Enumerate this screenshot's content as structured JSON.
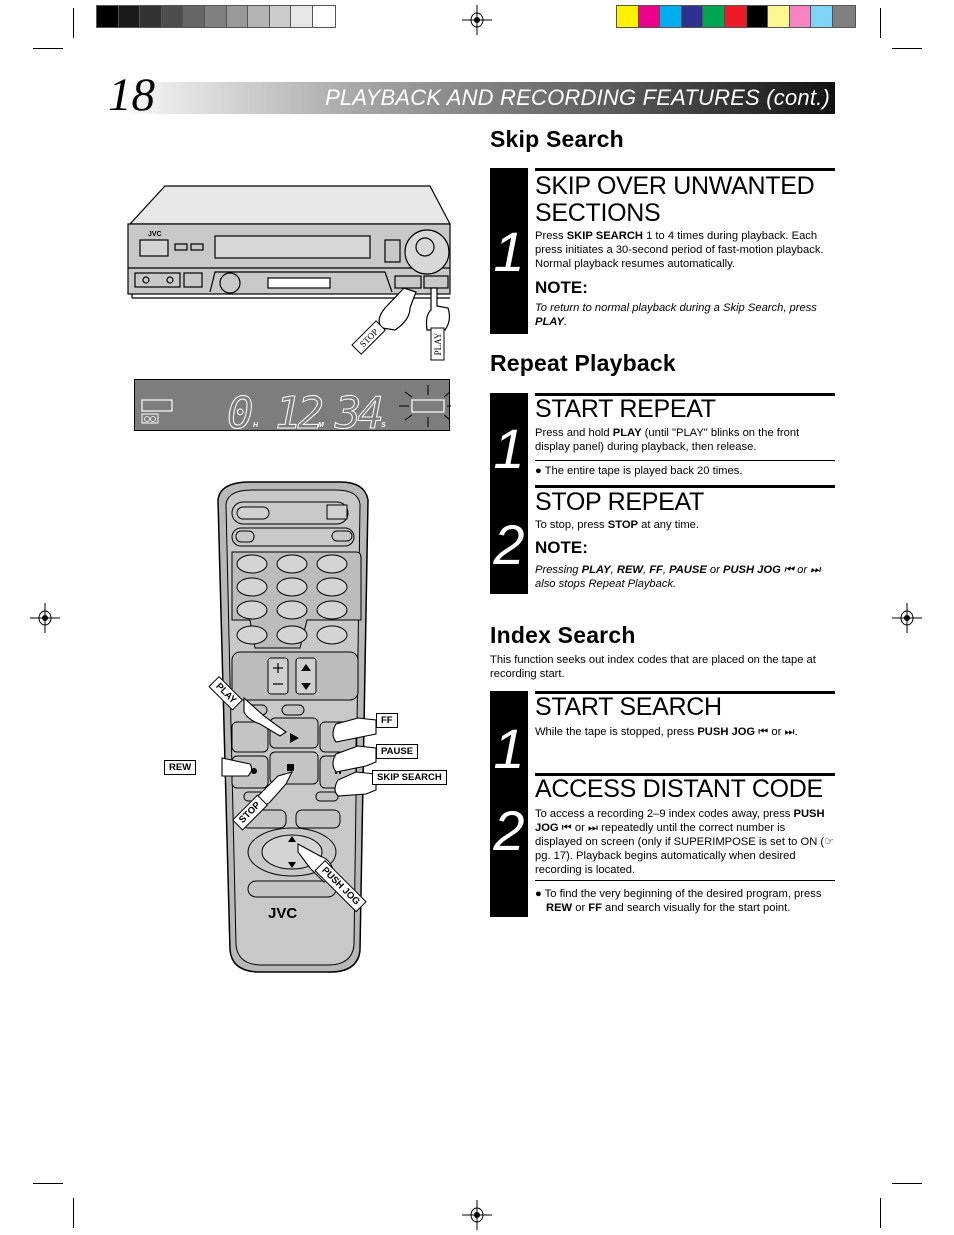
{
  "header": {
    "page_number": "18",
    "title": "PLAYBACK AND RECORDING FEATURES (cont.)"
  },
  "color_bars": {
    "grayscale": [
      "#000000",
      "#1a1a1a",
      "#333333",
      "#4d4d4d",
      "#666666",
      "#808080",
      "#999999",
      "#b3b3b3",
      "#cccccc",
      "#e6e6e6",
      "#ffffff"
    ],
    "colors": [
      "#fff200",
      "#ec008c",
      "#00aeef",
      "#2e3192",
      "#00a651",
      "#ed1c24",
      "#000000",
      "#fff68f",
      "#f684c2",
      "#7dd4f5",
      "#808080"
    ]
  },
  "skip_search": {
    "heading": "Skip Search",
    "steps": [
      {
        "number": "1",
        "title_line1": "SKIP OVER UNWANTED",
        "title_line2": "SECTIONS",
        "text_pre": "Press ",
        "text_bold": "SKIP SEARCH",
        "text_post": " 1 to 4 times during playback. Each press initiates a 30-second period of fast-motion playback. Normal playback resumes automatically.",
        "note_label": "NOTE:",
        "note_pre": "To return to normal playback during a Skip Search, press ",
        "note_bold": "PLAY",
        "note_post": "."
      }
    ]
  },
  "repeat_playback": {
    "heading": "Repeat Playback",
    "steps": [
      {
        "number": "1",
        "title": "START REPEAT",
        "text_pre": "Press and hold ",
        "text_bold": "PLAY",
        "text_post": " (until \"PLAY\" blinks on the front display panel) during playback, then release.",
        "bullet": "The entire tape is played back 20 times."
      },
      {
        "number": "2",
        "title": "STOP REPEAT",
        "text_pre": "To stop, press ",
        "text_bold": "STOP",
        "text_post": " at any time.",
        "note_label": "NOTE:",
        "note_parts": [
          "Pressing ",
          "PLAY",
          ", ",
          "REW",
          ", ",
          "FF",
          ", ",
          "PAUSE",
          " or ",
          "PUSH JOG",
          " ⏮ or ⏭ also stops Repeat Playback."
        ]
      }
    ]
  },
  "index_search": {
    "heading": "Index Search",
    "intro": "This function seeks out index codes that are placed on the tape at recording start.",
    "steps": [
      {
        "number": "1",
        "title": "START SEARCH",
        "text_pre": "While the tape is stopped, press ",
        "text_bold": "PUSH JOG",
        "text_post": " ⏮ or ⏭."
      },
      {
        "number": "2",
        "title": "ACCESS DISTANT CODE",
        "text_pre": "To access a recording 2–9 index codes away, press ",
        "text_bold": "PUSH JOG",
        "text_post": " ⏮ or ⏭ repeatedly until the correct number is displayed on screen (only if SUPERIMPOSE is set to ON (☞ pg. 17). Playback begins automatically when desired recording is located.",
        "bullet_pre": "To find the very beginning of the desired program, press ",
        "bullet_bold1": "REW",
        "bullet_mid": " or ",
        "bullet_bold2": "FF",
        "bullet_post": " and search visually for the start point."
      }
    ]
  },
  "vcr_illustration": {
    "brand": "JVC",
    "callouts": {
      "stop": "STOP",
      "play": "PLAY"
    }
  },
  "display_panel": {
    "hours": "0",
    "minutes": "12",
    "seconds": "34",
    "unit_h": "H",
    "unit_m": "M",
    "unit_s": "S"
  },
  "remote_illustration": {
    "brand": "JVC",
    "callouts": {
      "play": "PLAY",
      "ff": "FF",
      "pause": "PAUSE",
      "rew": "REW",
      "skip_search": "SKIP SEARCH",
      "stop": "STOP",
      "push_jog": "PUSH JOG"
    }
  }
}
